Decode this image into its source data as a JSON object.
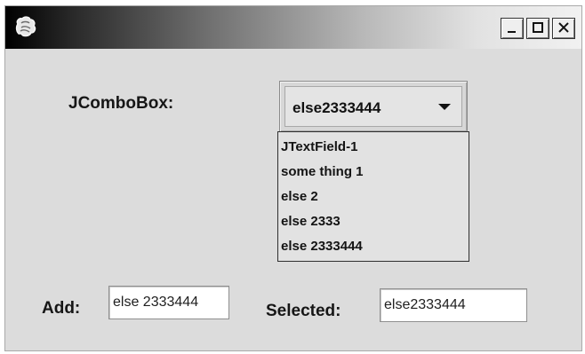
{
  "window": {
    "icon": "app-icon",
    "buttons": [
      {
        "name": "minimize-icon",
        "glyph": "_"
      },
      {
        "name": "maximize-icon",
        "glyph": "□"
      },
      {
        "name": "close-icon",
        "glyph": "X"
      }
    ]
  },
  "combo": {
    "label": "JComboBox:",
    "selected": "else2333444",
    "arrow_icon": "dropdown-arrow-icon",
    "items": [
      "JTextField-1",
      "some thing 1",
      "else 2",
      "else 2333",
      "else 2333444"
    ]
  },
  "add": {
    "label": "Add:",
    "value": "else 2333444"
  },
  "selected_field": {
    "label": "Selected:",
    "value": "else2333444"
  },
  "colors": {
    "window_background": "#dcdcdc",
    "titlebar_dark": "#000000",
    "titlebar_light": "#f1f1f1",
    "field_background": "#ffffff"
  }
}
